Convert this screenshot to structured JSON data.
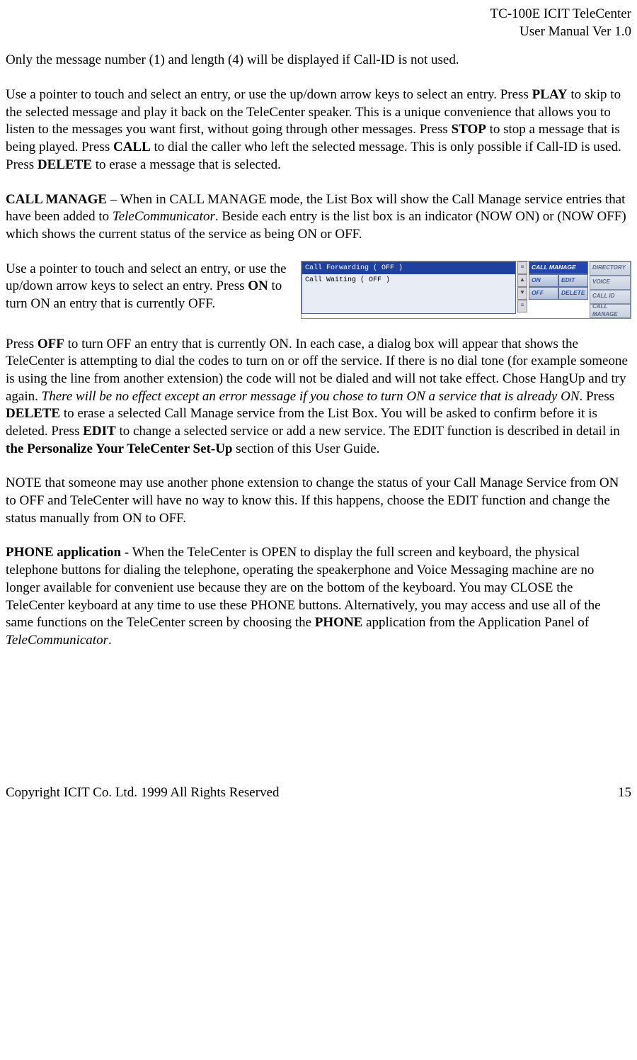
{
  "header": {
    "line1": "TC-100E ICIT TeleCenter",
    "line2": "User Manual  Ver 1.0"
  },
  "para1": "Only the message number (1) and length (4) will be displayed if Call-ID is not used.",
  "para2": {
    "t1": "Use a pointer to touch and select an entry, or use the up/down arrow keys to select an entry. Press ",
    "b1": "PLAY",
    "t2": " to skip to the selected message and play it back on the TeleCenter speaker. This is a unique convenience that allows you to listen to the messages you want first, without going through other messages. Press ",
    "b2": "STOP",
    "t3": " to stop a message that is being played. Press ",
    "b3": "CALL",
    "t4": " to dial the caller who left the selected message. This is only possible if Call-ID is used. Press ",
    "b4": "DELETE",
    "t5": " to erase a message that is selected."
  },
  "para3": {
    "b1": "CALL MANAGE",
    "t1": " – When in CALL MANAGE mode, the List Box will show the Call Manage service entries that have been added to ",
    "i1": "TeleCommunicator",
    "t2": ".  Beside each entry is the list box  is an indicator (NOW ON) or (NOW OFF) which shows the current status of the service as being ON or OFF."
  },
  "para4": {
    "t1": "Use a pointer to touch and select an entry, or use the up/down arrow keys to select an entry. Press ",
    "b1": "ON",
    "t2": " to turn ON an entry that is currently OFF."
  },
  "figure": {
    "listbox": {
      "row1": "Call Forwarding    ( OFF )",
      "row2": "Call Waiting       ( OFF )"
    },
    "buttons": {
      "callmanage": "CALL MANAGE",
      "on": "ON",
      "edit": "EDIT",
      "off": "OFF",
      "delete": "DELETE"
    },
    "tabs": {
      "directory": "DIRECTORY",
      "voice": "VOICE",
      "callid": "CALL ID",
      "callmanage": "CALL MANAGE"
    }
  },
  "para5": {
    "t1": "Press ",
    "b1": "OFF",
    "t2": " to turn OFF an entry that is currently ON. In each case, a dialog box will appear that shows the TeleCenter is attempting to dial the codes to turn on or off the service. If there is no dial tone (for example someone is using the line from another extension) the code will not be dialed and will not take effect. Chose HangUp and try again. ",
    "i1": "There will be no effect except an error message if you chose to turn ON a service that is already ON",
    "t3": ". Press ",
    "b2": "DELETE",
    "t4": " to erase a selected Call Manage service from the List Box. You will be asked to confirm before it is deleted.  Press ",
    "b3": "EDIT",
    "t5": " to change a selected service or add a new service. The EDIT function is described in detail in ",
    "b4": "the Personalize Your TeleCenter Set-Up",
    "t6": " section of this User Guide."
  },
  "para6": "NOTE that someone may use another phone extension to change the status of your Call Manage Service from ON to OFF and TeleCenter will have no way to know this. If this happens, choose the EDIT function and change the status manually from ON to OFF.",
  "para7": {
    "b1": "PHONE  application -",
    "t1": " When the TeleCenter is OPEN to display the full screen and keyboard, the physical telephone buttons for dialing the telephone, operating the speakerphone and Voice Messaging machine are no longer available for convenient use because they are on the bottom of the keyboard. You may CLOSE the TeleCenter keyboard at any time to use these PHONE buttons. Alternatively, you may access and use all of the same functions on the TeleCenter screen by choosing the ",
    "b2": "PHONE",
    "t2": " application from the Application Panel of ",
    "i1": "TeleCommunicator",
    "t3": "."
  },
  "footer": {
    "left": "Copyright ICIT Co. Ltd. 1999  All Rights Reserved",
    "right": "15"
  }
}
